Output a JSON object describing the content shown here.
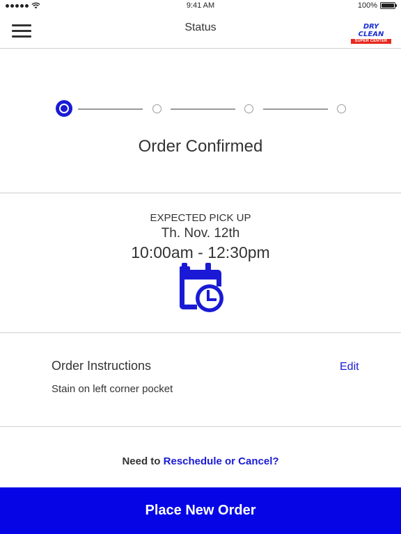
{
  "status_bar": {
    "time": "9:41 AM",
    "battery": "100%",
    "battery_level": 1.0
  },
  "nav": {
    "title": "Status",
    "logo_line1": "DRY CLEAN",
    "logo_line2": "SUPER CENTER"
  },
  "progress": {
    "steps_total": 4,
    "current_step": 1,
    "status_title": "Order Confirmed"
  },
  "pickup": {
    "label": "EXPECTED PICK UP",
    "date": "Th. Nov. 12th",
    "time": "10:00am - 12:30pm"
  },
  "instructions": {
    "title": "Order Instructions",
    "edit_label": "Edit",
    "text": "Stain on left corner pocket"
  },
  "reschedule": {
    "prefix": "Need to ",
    "link": "Reschedule or Cancel?"
  },
  "footer": {
    "button_label": "Place New Order"
  },
  "colors": {
    "accent": "#1a1ad6",
    "button": "#0505e6",
    "logo_blue": "#1a2fd6",
    "logo_red": "#e8281e"
  },
  "icons": {
    "menu": "hamburger-icon",
    "calendar": "calendar-clock-icon",
    "wifi": "wifi-icon",
    "battery": "battery-icon"
  }
}
